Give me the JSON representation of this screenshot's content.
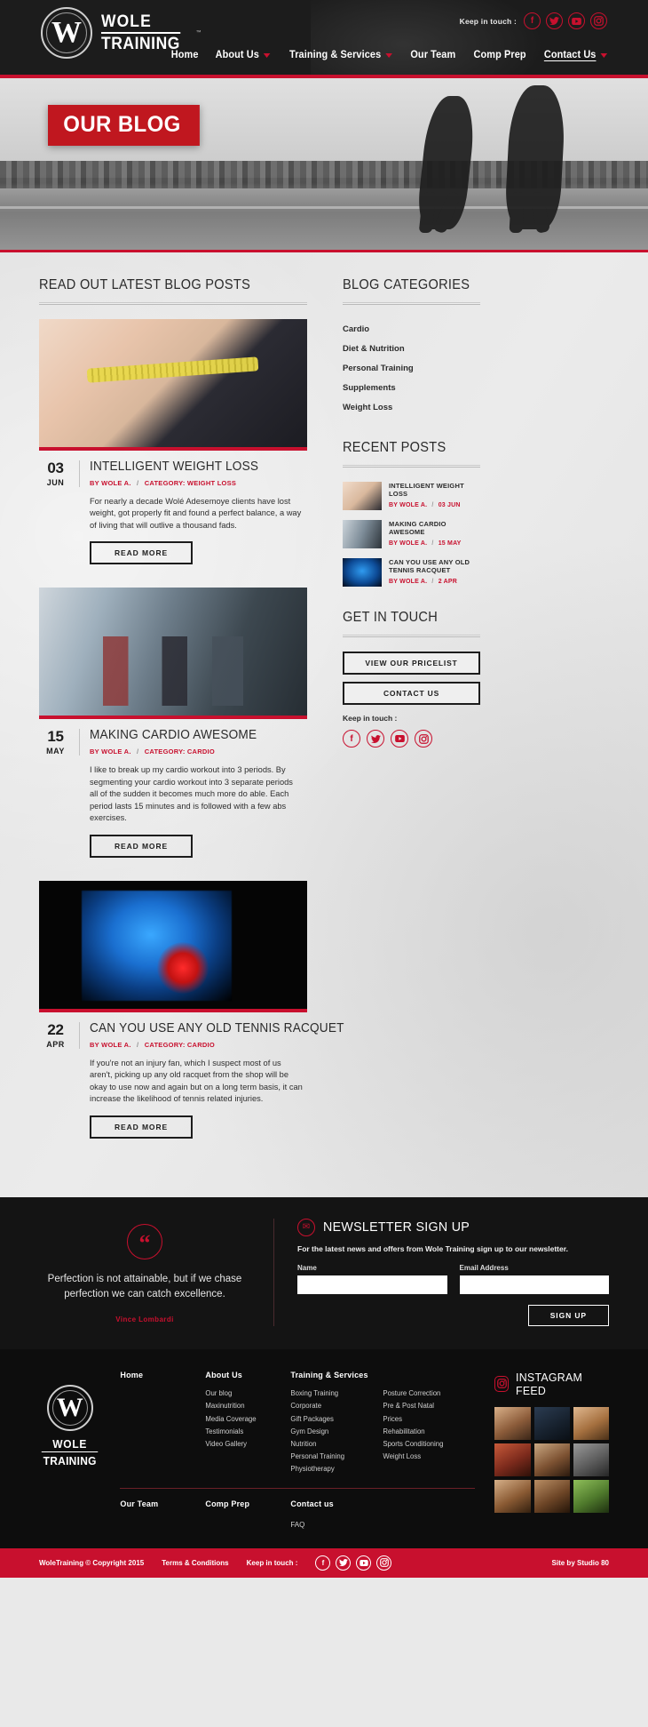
{
  "header": {
    "brand": {
      "line1": "WOLE",
      "line2": "TRAINING",
      "mark": "W",
      "tm": "™"
    },
    "keep_in_touch_label": "Keep in touch :",
    "socials": [
      "facebook-icon",
      "twitter-icon",
      "youtube-icon",
      "instagram-icon"
    ],
    "nav": [
      {
        "label": "Home",
        "caret": false,
        "active": false
      },
      {
        "label": "About Us",
        "caret": true,
        "active": false
      },
      {
        "label": "Training & Services",
        "caret": true,
        "active": false
      },
      {
        "label": "Our Team",
        "caret": false,
        "active": false
      },
      {
        "label": "Comp Prep",
        "caret": false,
        "active": false
      },
      {
        "label": "Contact Us",
        "caret": true,
        "active": true
      }
    ]
  },
  "hero": {
    "title": "OUR BLOG"
  },
  "main": {
    "section_title": "READ OUT LATEST BLOG POSTS",
    "read_more_label": "READ MORE",
    "posts": [
      {
        "day": "03",
        "month": "JUN",
        "title": "INTELLIGENT WEIGHT LOSS",
        "author": "BY WOLE A.",
        "category": "CATEGORY: WEIGHT LOSS",
        "excerpt": "For nearly a decade Wolé Adesemoye clients have lost weight, got properly fit and found a perfect balance, a way of living that will outlive a thousand fads."
      },
      {
        "day": "15",
        "month": "MAY",
        "title": "MAKING CARDIO AWESOME",
        "author": "BY WOLE A.",
        "category": "CATEGORY: CARDIO",
        "excerpt": "I like to break up my cardio workout into 3 periods. By segmenting your cardio workout into 3 separate periods all of the sudden it becomes much more do able. Each period lasts 15 minutes and is followed with a few abs exercises."
      },
      {
        "day": "22",
        "month": "APR",
        "title": "CAN YOU USE ANY OLD TENNIS RACQUET",
        "author": "BY WOLE A.",
        "category": "CATEGORY: CARDIO",
        "excerpt": "If you're not an injury fan, which I suspect most of us aren't, picking up any old racquet from the shop will be okay to use now and again but on a long term basis, it can increase the likelihood of tennis related injuries."
      }
    ]
  },
  "sidebar": {
    "categories_title": "BLOG CATEGORIES",
    "categories": [
      "Cardio",
      "Diet & Nutrition",
      "Personal Training",
      "Supplements",
      "Weight Loss"
    ],
    "recent_title": "RECENT POSTS",
    "recent_posts": [
      {
        "title": "INTELLIGENT WEIGHT LOSS",
        "author": "BY WOLE A.",
        "date": "03 JUN"
      },
      {
        "title": "MAKING CARDIO AWESOME",
        "author": "BY WOLE A.",
        "date": "15 MAY"
      },
      {
        "title": "CAN YOU USE ANY OLD TENNIS RACQUET",
        "author": "BY WOLE A.",
        "date": "2 APR"
      }
    ],
    "get_in_touch_title": "GET IN TOUCH",
    "pricelist_button": "VIEW OUR PRICELIST",
    "contact_button": "CONTACT US",
    "keep_in_touch_label": "Keep in touch :"
  },
  "newsletter": {
    "quote": "Perfection is not attainable, but if we chase perfection we can catch excellence.",
    "quote_author": "Vince Lombardi",
    "title": "NEWSLETTER SIGN UP",
    "subtitle": "For the latest news and offers from Wole Training sign up to our newsletter.",
    "name_label": "Name",
    "name_value": "",
    "name_placeholder": "",
    "email_label": "Email Address",
    "email_value": "",
    "email_placeholder": "",
    "submit_label": "SIGN UP"
  },
  "footer": {
    "brand": {
      "line1": "WOLE",
      "line2": "TRAINING",
      "mark": "W",
      "tm": "™"
    },
    "columns": [
      {
        "head": "Home",
        "items": []
      },
      {
        "head": "About Us",
        "items": [
          "Our blog",
          "Maxinutrition",
          "Media Coverage",
          "Testimonials",
          "Video Gallery"
        ]
      },
      {
        "head": "Training & Services",
        "items": [
          "Boxing Training",
          "Corporate",
          "Gift Packages",
          "Gym Design",
          "Nutrition",
          "Personal Training",
          "Physiotherapy"
        ]
      },
      {
        "head": "",
        "items": [
          "Posture Correction",
          "Pre & Post Natal",
          "Prices",
          "Rehabilitation",
          "Sports Conditioning",
          "Weight Loss"
        ]
      }
    ],
    "row2": [
      "Our Team",
      "Comp Prep",
      "Contact us"
    ],
    "faq": "FAQ",
    "instagram_title": "INSTAGRAM FEED"
  },
  "bottombar": {
    "copyright": "WoleTraining © Copyright 2015",
    "terms": "Terms & Conditions",
    "keep_in_touch_label": "Keep in touch :",
    "credit": "Site by Studio 80"
  }
}
